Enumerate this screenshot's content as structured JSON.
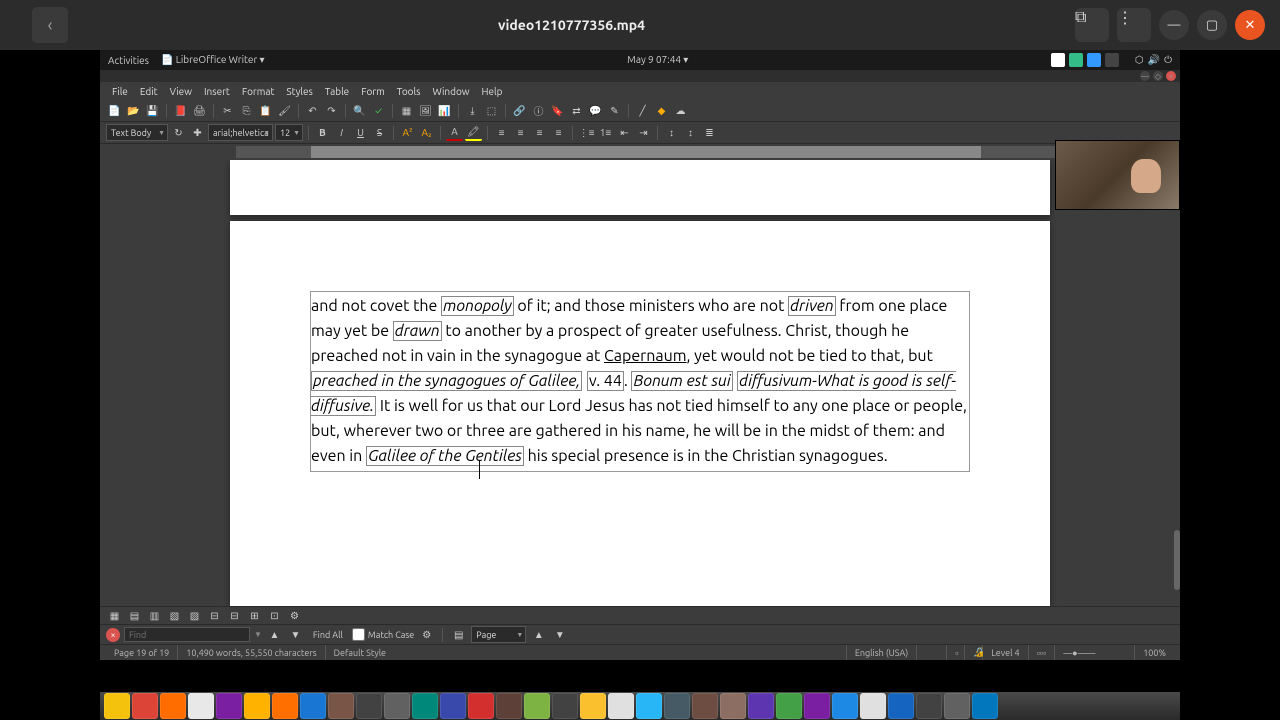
{
  "window": {
    "title": "video1210777356.mp4"
  },
  "gnome": {
    "activities": "Activities",
    "app": "LibreOffice Writer",
    "clock": "May 9  07:44"
  },
  "menu": {
    "items": [
      "File",
      "Edit",
      "View",
      "Insert",
      "Format",
      "Styles",
      "Table",
      "Form",
      "Tools",
      "Window",
      "Help"
    ]
  },
  "format": {
    "para_style": "Text Body",
    "font_name": "arial;helvetica",
    "font_size": "12"
  },
  "document": {
    "line1_pre": "and not covet the ",
    "monopoly": "monopoly",
    "line1_mid": " of it; and those ministers who are not ",
    "driven": "driven",
    "line1_post": " from one place may yet be ",
    "drawn": "drawn",
    "line2": " to another by a prospect of greater usefulness. Christ, though he preached not in vain in the synagogue at ",
    "capernaum": "Capernaum",
    "line2b": ", yet would not be tied to that, but ",
    "preached": "preached in the synagogues of Galilee,",
    "v44": "v. 44",
    "period1": ". ",
    "bonum": "Bonum est sui",
    "diffusivum": "diffusivum-What is good is self-diffusive.",
    "line3": " It is well for us that our Lord Jesus has not tied himself to any one place or people, but, wherever two or three are gathered in his name, he will be in the midst of them: and even in ",
    "galilee": "Galilee of the Gentiles",
    "line3_end": " his special presence is in the Christian synagogues."
  },
  "find": {
    "placeholder": "Find",
    "findall": "Find All",
    "matchcase": "Match Case",
    "nav_label": "Page",
    "nav_value": ""
  },
  "status": {
    "page": "Page 19 of 19",
    "words": "10,490 words, 55,550 characters",
    "style": "Default Style",
    "lang": "English (USA)",
    "level": "Level 4",
    "zoom": "100%"
  },
  "taskbar_colors": [
    "#f4c20d",
    "#db4437",
    "#ff6d00",
    "#e8e8e8",
    "#7b1fa2",
    "#ffb300",
    "#ff6f00",
    "#1976d2",
    "#795548",
    "#424242",
    "#616161",
    "#00897b",
    "#3949ab",
    "#d32f2f",
    "#5d4037",
    "#7cb342",
    "#424242",
    "#fbc02d",
    "#e0e0e0",
    "#29b6f6",
    "#455a64",
    "#6d4c41",
    "#8d6e63",
    "#5e35b1",
    "#43a047",
    "#7b1fa2",
    "#1e88e5",
    "#e0e0e0",
    "#1565c0",
    "#424242",
    "#616161",
    "#0277bd"
  ]
}
